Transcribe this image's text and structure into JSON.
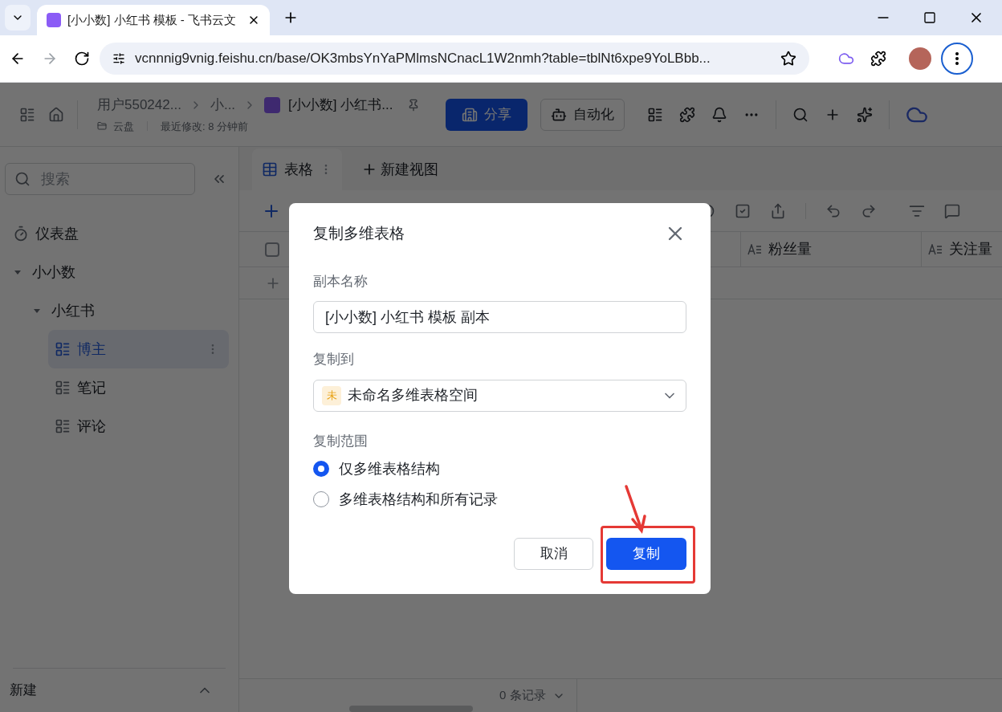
{
  "browser": {
    "tab_title": "[小小数] 小红书 模板 - 飞书云文",
    "url": "vcnnnig9vnig.feishu.cn/base/OK3mbsYnYaPMlmsNCnacL1W2nmh?table=tblNt6xpe9YoLBbb..."
  },
  "header": {
    "breadcrumb": [
      "用户550242...",
      "小...",
      "[小小数] 小红书..."
    ],
    "location": "云盘",
    "modified": "最近修改: 8 分钟前",
    "share": "分享",
    "automation": "自动化"
  },
  "sidebar": {
    "search": {
      "placeholder": "搜索"
    },
    "items": [
      {
        "label": "仪表盘",
        "kind": "dashboard",
        "selected": false
      },
      {
        "label": "小小数",
        "kind": "folder",
        "expanded": true,
        "selected": false,
        "children": [
          {
            "label": "小红书",
            "kind": "folder",
            "expanded": true,
            "selected": false,
            "children": [
              {
                "label": "博主",
                "kind": "table",
                "selected": true
              },
              {
                "label": "笔记",
                "kind": "table",
                "selected": false
              },
              {
                "label": "评论",
                "kind": "table",
                "selected": false
              }
            ]
          }
        ]
      }
    ],
    "new": "新建"
  },
  "views": {
    "tabs": [
      {
        "label": "表格",
        "selected": true
      }
    ],
    "new_view": "新建视图"
  },
  "table": {
    "select_all_checked": false,
    "columns": [
      "粉丝量",
      "关注量"
    ]
  },
  "status_bar": {
    "records": "0 条记录"
  },
  "dialog": {
    "title": "复制多维表格",
    "name_label": "副本名称",
    "name_value": "[小小数] 小红书 模板 副本",
    "dest_label": "复制到",
    "dest_badge": "未",
    "dest_value": "未命名多维表格空间",
    "scope_label": "复制范围",
    "scope_options": [
      {
        "label": "仅多维表格结构",
        "selected": true
      },
      {
        "label": "多维表格结构和所有记录",
        "selected": false
      }
    ],
    "cancel": "取消",
    "confirm": "复制",
    "confirm_highlighted": true
  }
}
